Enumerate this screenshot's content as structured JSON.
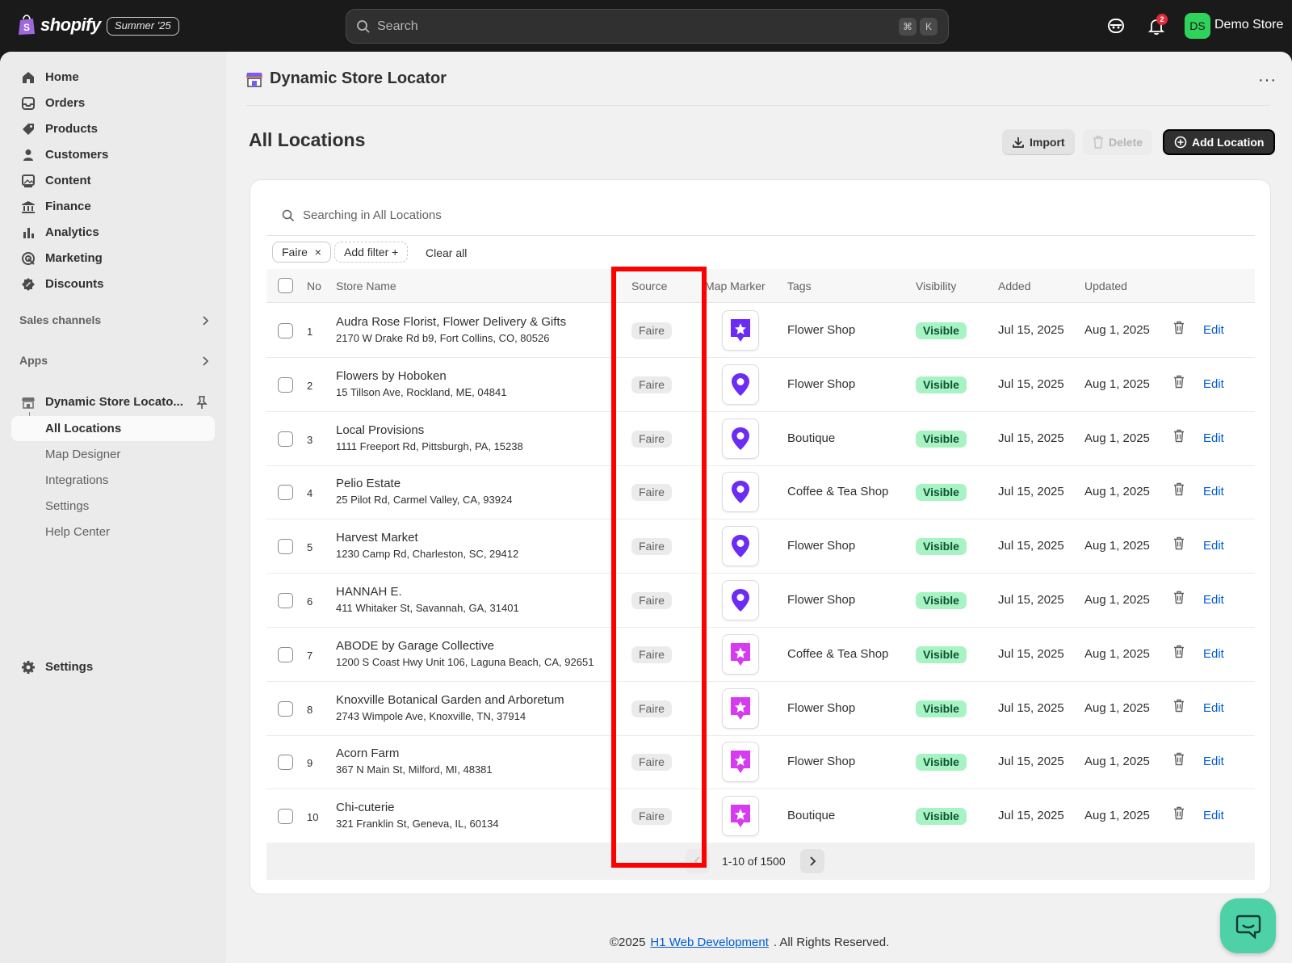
{
  "topbar": {
    "logo_text": "shopify",
    "edition": "Summer '25",
    "search_placeholder": "Search",
    "kbd_cmd": "⌘",
    "kbd_k": "K",
    "notification_count": "2",
    "avatar_initials": "DS",
    "store_name": "Demo Store"
  },
  "sidebar": {
    "items": [
      {
        "label": "Home",
        "icon": "home-icon"
      },
      {
        "label": "Orders",
        "icon": "inbox-icon"
      },
      {
        "label": "Products",
        "icon": "tag-icon"
      },
      {
        "label": "Customers",
        "icon": "person-icon"
      },
      {
        "label": "Content",
        "icon": "image-icon"
      },
      {
        "label": "Finance",
        "icon": "bank-icon"
      },
      {
        "label": "Analytics",
        "icon": "bar-chart-icon"
      },
      {
        "label": "Marketing",
        "icon": "target-icon"
      },
      {
        "label": "Discounts",
        "icon": "discount-icon"
      }
    ],
    "sales_channels": "Sales channels",
    "apps": "Apps",
    "app_name": "Dynamic Store Locato...",
    "sub_items": [
      "All Locations",
      "Map Designer",
      "Integrations",
      "Settings",
      "Help Center"
    ],
    "settings": "Settings"
  },
  "header": {
    "app_title": "Dynamic Store Locator",
    "more": "···"
  },
  "page": {
    "title": "All Locations",
    "import_label": "Import",
    "delete_label": "Delete",
    "add_label": "Add Location"
  },
  "filters": {
    "search_placeholder": "Searching in All Locations",
    "chip_faire": "Faire",
    "chip_close": "×",
    "add_filter": "Add filter +",
    "clear_all": "Clear all"
  },
  "table": {
    "columns": [
      "No",
      "Store Name",
      "Source",
      "Map Marker",
      "Tags",
      "Visibility",
      "Added",
      "Updated"
    ],
    "rows": [
      {
        "no": "1",
        "name": "Audra Rose Florist, Flower Delivery & Gifts",
        "address": "2170 W Drake Rd b9, Fort Collins, CO, 80526",
        "source": "Faire",
        "marker": "purple-star-marker",
        "tags": "Flower Shop",
        "visibility": "Visible",
        "added": "Jul 15, 2025",
        "updated": "Aug 1, 2025",
        "edit": "Edit"
      },
      {
        "no": "2",
        "name": "Flowers by Hoboken",
        "address": "15 Tillson Ave, Rockland, ME, 04841",
        "source": "Faire",
        "marker": "purple-pin-marker",
        "tags": "Flower Shop",
        "visibility": "Visible",
        "added": "Jul 15, 2025",
        "updated": "Aug 1, 2025",
        "edit": "Edit"
      },
      {
        "no": "3",
        "name": "Local Provisions",
        "address": "1111 Freeport Rd, Pittsburgh, PA, 15238",
        "source": "Faire",
        "marker": "purple-pin-marker",
        "tags": "Boutique",
        "visibility": "Visible",
        "added": "Jul 15, 2025",
        "updated": "Aug 1, 2025",
        "edit": "Edit"
      },
      {
        "no": "4",
        "name": "Pelio Estate",
        "address": "25 Pilot Rd, Carmel Valley, CA, 93924",
        "source": "Faire",
        "marker": "purple-pin-marker",
        "tags": "Coffee & Tea Shop",
        "visibility": "Visible",
        "added": "Jul 15, 2025",
        "updated": "Aug 1, 2025",
        "edit": "Edit"
      },
      {
        "no": "5",
        "name": "Harvest Market",
        "address": "1230 Camp Rd, Charleston, SC, 29412",
        "source": "Faire",
        "marker": "purple-pin-marker",
        "tags": "Flower Shop",
        "visibility": "Visible",
        "added": "Jul 15, 2025",
        "updated": "Aug 1, 2025",
        "edit": "Edit"
      },
      {
        "no": "6",
        "name": "HANNAH E.",
        "address": "411 Whitaker St, Savannah, GA, 31401",
        "source": "Faire",
        "marker": "purple-pin-marker",
        "tags": "Flower Shop",
        "visibility": "Visible",
        "added": "Jul 15, 2025",
        "updated": "Aug 1, 2025",
        "edit": "Edit"
      },
      {
        "no": "7",
        "name": "ABODE by Garage Collective",
        "address": "1200 S Coast Hwy Unit 106, Laguna Beach, CA, 92651",
        "source": "Faire",
        "marker": "magenta-star-marker",
        "tags": "Coffee & Tea Shop",
        "visibility": "Visible",
        "added": "Jul 15, 2025",
        "updated": "Aug 1, 2025",
        "edit": "Edit"
      },
      {
        "no": "8",
        "name": "Knoxville Botanical Garden and Arboretum",
        "address": "2743 Wimpole Ave, Knoxville, TN, 37914",
        "source": "Faire",
        "marker": "magenta-star-marker",
        "tags": "Flower Shop",
        "visibility": "Visible",
        "added": "Jul 15, 2025",
        "updated": "Aug 1, 2025",
        "edit": "Edit"
      },
      {
        "no": "9",
        "name": "Acorn Farm",
        "address": "367 N Main St, Milford, MI, 48381",
        "source": "Faire",
        "marker": "magenta-star-marker",
        "tags": "Flower Shop",
        "visibility": "Visible",
        "added": "Jul 15, 2025",
        "updated": "Aug 1, 2025",
        "edit": "Edit"
      },
      {
        "no": "10",
        "name": "Chi-cuterie",
        "address": "321 Franklin St, Geneva, IL, 60134",
        "source": "Faire",
        "marker": "magenta-star-marker",
        "tags": "Boutique",
        "visibility": "Visible",
        "added": "Jul 15, 2025",
        "updated": "Aug 1, 2025",
        "edit": "Edit"
      }
    ]
  },
  "pagination": {
    "text": "1-10 of 1500"
  },
  "footer": {
    "prefix": "©2025",
    "link": "H1 Web Development",
    "suffix": ". All Rights Reserved."
  },
  "colors": {
    "accent": "#005bd3",
    "visible_bg": "#a7f3c3",
    "highlight": "#ff0000",
    "marker_purple": "#6b2cf5",
    "marker_magenta": "#d63bf0",
    "chat": "#4fd1a8"
  }
}
